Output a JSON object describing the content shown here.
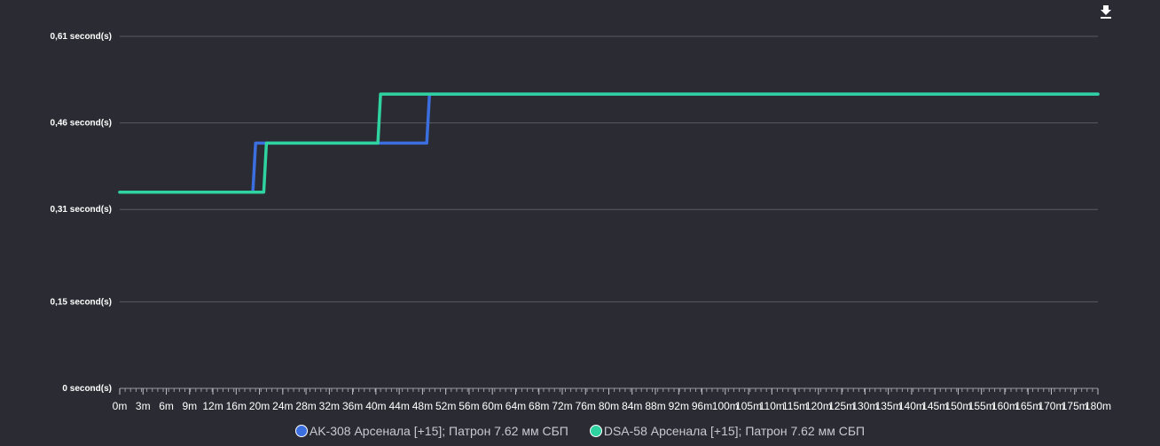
{
  "chart_data": {
    "type": "line",
    "title": "",
    "xlabel": "",
    "ylabel": "",
    "y_ticks": [
      "0 second(s)",
      "0,15 second(s)",
      "0,31 second(s)",
      "0,46 second(s)",
      "0,61 second(s)"
    ],
    "y_tick_values": [
      0,
      0.15,
      0.31,
      0.46,
      0.61
    ],
    "ylim": [
      0,
      0.61
    ],
    "x_ticks": [
      "0m",
      "3m",
      "6m",
      "9m",
      "12m",
      "16m",
      "20m",
      "24m",
      "28m",
      "32m",
      "36m",
      "40m",
      "44m",
      "48m",
      "52m",
      "56m",
      "60m",
      "64m",
      "68m",
      "72m",
      "76m",
      "80m",
      "84m",
      "88m",
      "92m",
      "96m",
      "100m",
      "105m",
      "110m",
      "115m",
      "120m",
      "125m",
      "130m",
      "135m",
      "140m",
      "145m",
      "150m",
      "155m",
      "160m",
      "165m",
      "170m",
      "175m",
      "180m"
    ],
    "x_tick_values": [
      0,
      3,
      6,
      9,
      12,
      16,
      20,
      24,
      28,
      32,
      36,
      40,
      44,
      48,
      52,
      56,
      60,
      64,
      68,
      72,
      76,
      80,
      84,
      88,
      92,
      96,
      100,
      105,
      110,
      115,
      120,
      125,
      130,
      135,
      140,
      145,
      150,
      155,
      160,
      165,
      170,
      175,
      180
    ],
    "xlim": [
      0,
      180
    ],
    "grid": true,
    "legend_position": "bottom",
    "series": [
      {
        "name": "AK-308 Арсенала [+15]; Патрон 7.62 мм СБП",
        "color": "#3b6fe0",
        "x": [
          0,
          24.5,
          25,
          56.5,
          57,
          180
        ],
        "y": [
          0.34,
          0.34,
          0.425,
          0.425,
          0.51,
          0.51
        ]
      },
      {
        "name": "DSA-58 Арсенала [+15]; Патрон 7.62 мм СБП",
        "color": "#2fd3a0",
        "x": [
          0,
          26.5,
          27,
          47.5,
          48,
          180
        ],
        "y": [
          0.34,
          0.34,
          0.425,
          0.425,
          0.51,
          0.51
        ]
      }
    ]
  },
  "toolbar": {
    "download_icon": "download-icon"
  },
  "colors": {
    "background": "#2b2b33",
    "grid": "#5a5a62",
    "text": "#ffffff",
    "legend_text": "#c9c9cf"
  }
}
